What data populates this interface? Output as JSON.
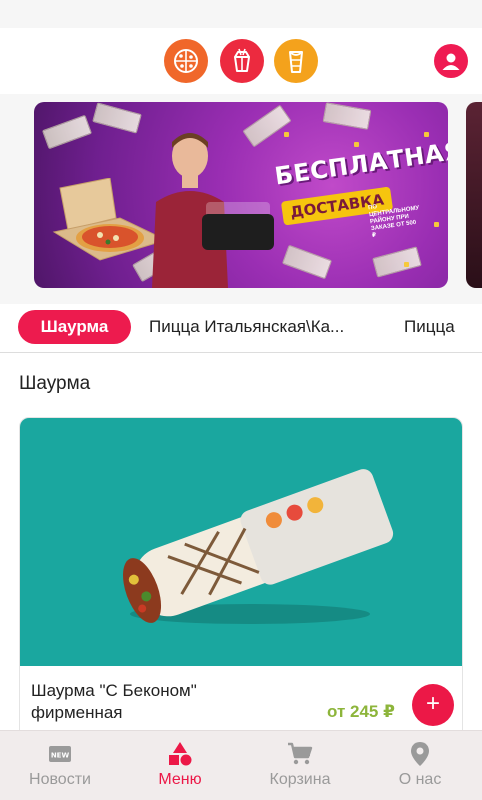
{
  "header": {
    "categories": [
      {
        "icon": "pizza-icon",
        "color": "#f0672a"
      },
      {
        "icon": "noodle-box-icon",
        "color": "#ec2a3f"
      },
      {
        "icon": "shawarma-roll-icon",
        "color": "#f4a21c"
      }
    ],
    "profile_icon": "profile-icon"
  },
  "banner": {
    "title": "БЕСПЛАТНАЯ",
    "subtitle": "ДОСТАВКА",
    "note": "по центральному району при заказе от 500 ₽",
    "bill_label": "500"
  },
  "tabs": [
    {
      "label": "Шаурма",
      "active": true
    },
    {
      "label": "Пицца Итальянская\\Ка...",
      "active": false
    },
    {
      "label": "Пицца",
      "active": false
    }
  ],
  "section": {
    "title": "Шаурма"
  },
  "product": {
    "title": "Шаурма \"С Беконом\" фирменная",
    "price": "от 245 ₽",
    "add_label": "+"
  },
  "bottom_nav": [
    {
      "label": "Новости",
      "icon": "news-icon",
      "active": false
    },
    {
      "label": "Меню",
      "icon": "menu-shapes-icon",
      "active": true
    },
    {
      "label": "Корзина",
      "icon": "cart-icon",
      "active": false
    },
    {
      "label": "О нас",
      "icon": "location-pin-icon",
      "active": false
    }
  ],
  "colors": {
    "accent": "#ec1847",
    "price": "#8db53b",
    "card_image_bg": "#1aa79f"
  }
}
